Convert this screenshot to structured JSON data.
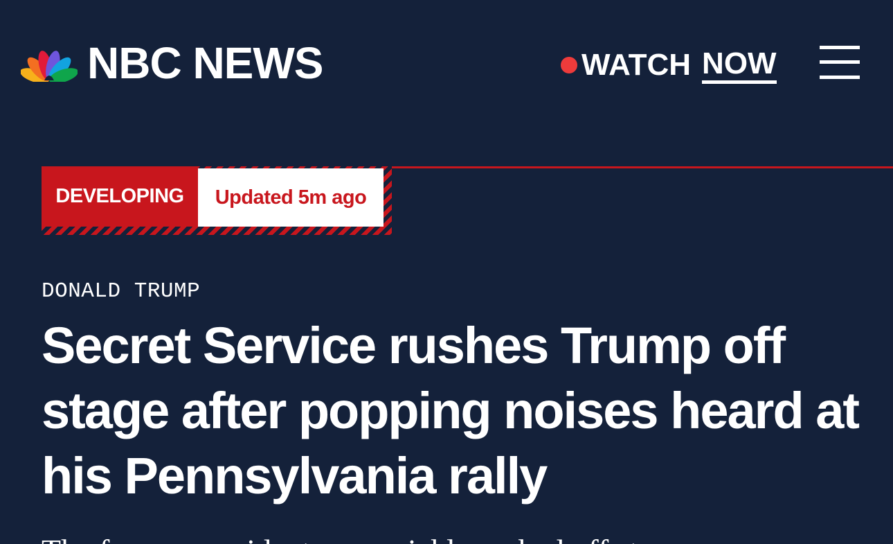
{
  "header": {
    "brand": "NBC NEWS",
    "logo_icon": "nbc-peacock-icon",
    "watch_label": "WATCH",
    "now_label": "NOW",
    "menu_icon": "hamburger-menu-icon"
  },
  "banner": {
    "status_label": "DEVELOPING",
    "updated_label": "Updated 5m ago"
  },
  "article": {
    "eyebrow": "DONALD TRUMP",
    "headline": "Secret Service rushes Trump off stage after popping noises heard at his Pennsylvania rally",
    "dek_partial": "The former president was quickly rushed off stage"
  },
  "colors": {
    "background": "#14213a",
    "accent_red": "#c8161d",
    "live_dot": "#ee3b3b",
    "text": "#ffffff"
  }
}
